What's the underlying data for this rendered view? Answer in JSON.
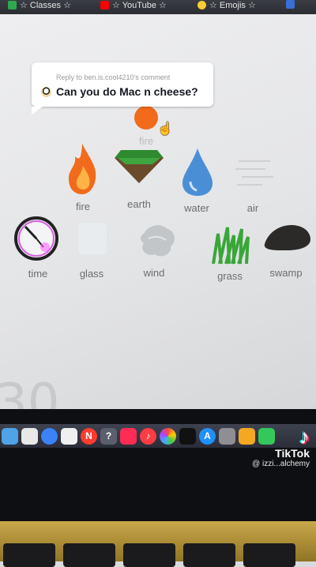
{
  "bookmarks": [
    {
      "label": "☆ Classes ☆",
      "color": "#2fa84f"
    },
    {
      "label": "☆ YouTube ☆",
      "color": "#ff0000"
    },
    {
      "label": "☆ Emojis ☆",
      "color": "#ffcc33"
    },
    {
      "label": "",
      "color": "#3b6fd8"
    }
  ],
  "comment": {
    "reply_to": "Reply to ben.is.cool4210's comment",
    "question": "Can you do Mac n cheese?"
  },
  "elements": {
    "fire_dragged": "fire",
    "fire": "fire",
    "earth": "earth",
    "water": "water",
    "air": "air",
    "time": "time",
    "glass": "glass",
    "wind": "wind",
    "grass": "grass",
    "swamp": "swamp"
  },
  "background_digit": "30",
  "dock_icons": [
    "finder-icon",
    "notes-icon",
    "browser-icon",
    "calendar-icon",
    "news-icon",
    "help-icon",
    "launchpad-icon",
    "music-icon",
    "photos-icon",
    "tv-icon",
    "appstore-icon",
    "settings-icon",
    "sketch-icon",
    "stats-icon"
  ],
  "watermark": {
    "app": "TikTok",
    "user": "@ izzi...alchemy"
  },
  "colors": {
    "fire": "#f26a1b",
    "water": "#4a8fd6",
    "grass": "#3aa63a",
    "swamp": "#2b2a28",
    "time_ring": "#cc22dd"
  }
}
